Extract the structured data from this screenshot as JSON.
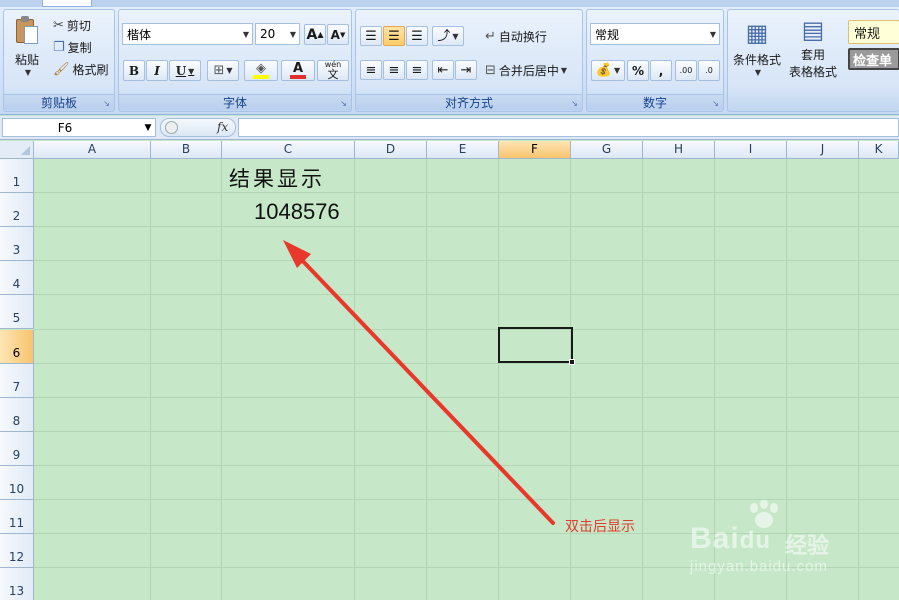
{
  "ribbon": {
    "clipboard": {
      "label": "剪贴板",
      "paste": "粘贴",
      "cut": "剪切",
      "copy": "复制",
      "format_painter": "格式刷"
    },
    "font": {
      "label": "字体",
      "font_name": "楷体",
      "font_size": "20",
      "grow": "A",
      "shrink": "A",
      "bold": "B",
      "italic": "I",
      "underline": "U",
      "font_color_letter": "A",
      "phonetic": "wén",
      "phonetic_char": "文"
    },
    "alignment": {
      "label": "对齐方式",
      "wrap_text": "自动换行",
      "merge_center": "合并后居中"
    },
    "number": {
      "label": "数字",
      "format": "常规",
      "percent": "%",
      "comma": ",",
      "inc_decimal": ".00",
      "dec_decimal": ".0"
    },
    "styles": {
      "conditional_format": "条件格式",
      "table_format_top": "套用",
      "table_format_bottom": "表格格式",
      "style_normal": "常规",
      "style_check": "检查单"
    }
  },
  "formula_bar": {
    "name_box": "F6",
    "fx": "fx",
    "content": ""
  },
  "grid": {
    "columns": [
      "A",
      "B",
      "C",
      "D",
      "E",
      "F",
      "G",
      "H",
      "I",
      "J",
      "K"
    ],
    "rows": [
      "1",
      "2",
      "3",
      "4",
      "5",
      "6",
      "7",
      "8",
      "9",
      "10",
      "11",
      "12",
      "13"
    ],
    "selected_column": "F",
    "selected_row": "6",
    "cells": {
      "C1": "结果显示",
      "C2": "1048576"
    }
  },
  "annotation": {
    "text": "双击后显示",
    "color": "#e03b2e"
  },
  "watermark": {
    "brand": "Bai",
    "brand_suffix": "du",
    "cn": "经验",
    "url": "jingyan.baidu.com"
  },
  "colors": {
    "sheet_background": "#c6e8c8",
    "gridline": "#b2d6b3",
    "header_selected": "#f9c46d",
    "ribbon": "#d4e3f6"
  }
}
